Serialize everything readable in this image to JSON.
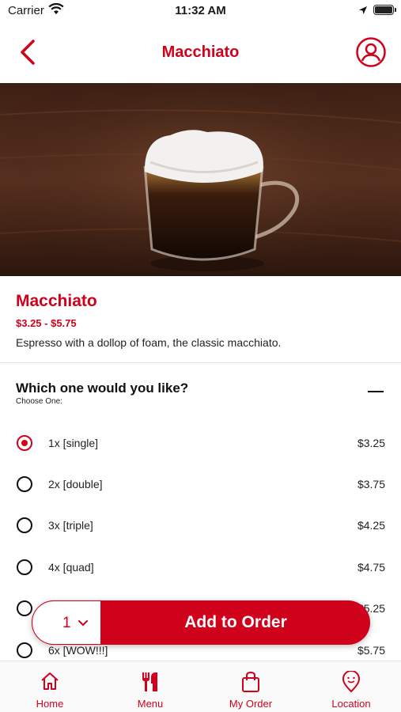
{
  "status_bar": {
    "carrier": "Carrier",
    "time": "11:32 AM"
  },
  "nav": {
    "title": "Macchiato",
    "icons": [
      "back-chevron-icon",
      "profile-icon"
    ]
  },
  "hero": {
    "image": "macchiato-cup-photo"
  },
  "item": {
    "name": "Macchiato",
    "price_range": "$3.25 - $5.75",
    "description": "Espresso with a dollop of foam, the classic macchiato."
  },
  "options_group": {
    "title": "Which one would you like?",
    "subtitle": "Choose One:",
    "selected_index": 0,
    "options": [
      {
        "label": "1x [single]",
        "price": "$3.25"
      },
      {
        "label": "2x [double]",
        "price": "$3.75"
      },
      {
        "label": "3x [triple]",
        "price": "$4.25"
      },
      {
        "label": "4x [quad]",
        "price": "$4.75"
      },
      {
        "label": "",
        "price": "$5.25"
      },
      {
        "label": "6x [WOW!!!]",
        "price": "$5.75"
      }
    ]
  },
  "order_bar": {
    "quantity": "1",
    "add_label": "Add to Order"
  },
  "tabs": [
    {
      "label": "Home",
      "icon": "home-icon"
    },
    {
      "label": "Menu",
      "icon": "fork-knife-icon"
    },
    {
      "label": "My Order",
      "icon": "shopping-bag-icon"
    },
    {
      "label": "Location",
      "icon": "location-pin-icon"
    }
  ],
  "colors": {
    "accent": "#d0021b"
  }
}
